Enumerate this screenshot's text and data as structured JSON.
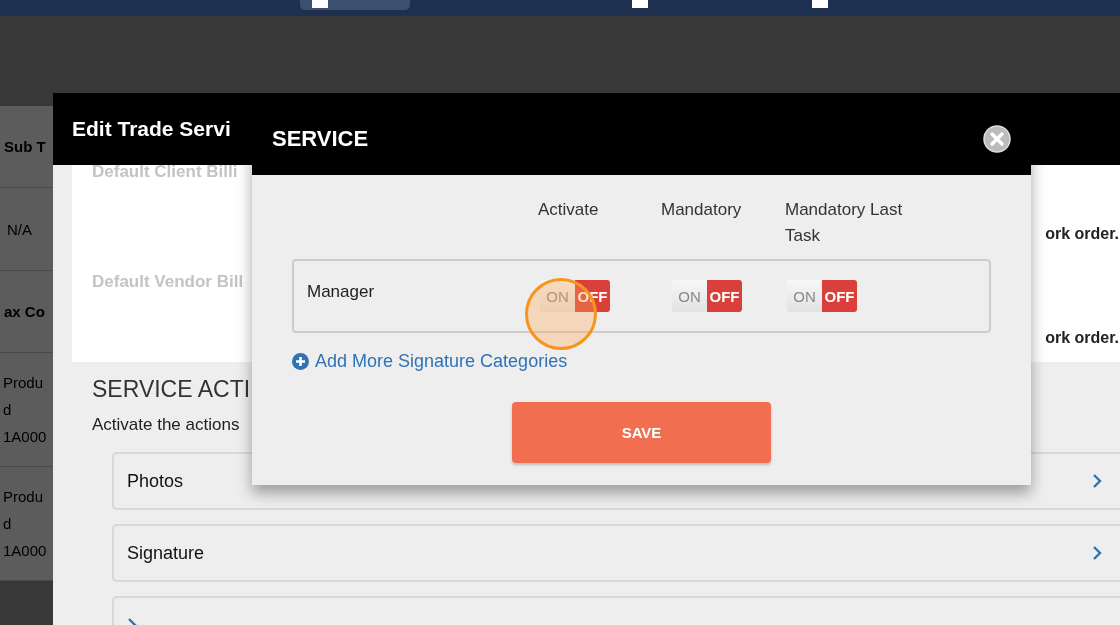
{
  "top_nav": {
    "items": [
      {
        "selected": true
      },
      {
        "selected": false
      },
      {
        "selected": false
      }
    ]
  },
  "background_table": {
    "cells": [
      {
        "text": "Sub T",
        "kind": "header"
      },
      {
        "text": "N/A",
        "kind": "value"
      },
      {
        "text": "ax Co",
        "kind": "header"
      },
      {
        "text": "Produ\nd\n1A000",
        "kind": "value"
      },
      {
        "text": "Produ\nd\n1A000",
        "kind": "value"
      }
    ]
  },
  "edit_modal": {
    "title": "Edit Trade Servi",
    "fields": [
      {
        "label": "Default Client Billi",
        "note": "ork order."
      },
      {
        "label": "Default Vendor Bill",
        "note": "ork order."
      }
    ],
    "section_title": "SERVICE ACTI",
    "section_description": "Activate the actions",
    "actions": [
      {
        "kind": "action",
        "label": "Photos"
      },
      {
        "kind": "action",
        "label": "Signature"
      },
      {
        "kind": "action"
      }
    ]
  },
  "service_modal": {
    "title": "SERVICE",
    "columns": [
      "Activate",
      "Mandatory",
      "Mandatory Last Task"
    ],
    "rows": [
      {
        "label": "Manager",
        "toggles": [
          {
            "on_label": "ON",
            "off_label": "OFF",
            "on": false
          },
          {
            "on_label": "ON",
            "off_label": "OFF",
            "on": false
          },
          {
            "on_label": "ON",
            "off_label": "OFF",
            "on": false
          }
        ]
      }
    ],
    "add_link": "Add More Signature Categories",
    "save_button": "SAVE"
  }
}
